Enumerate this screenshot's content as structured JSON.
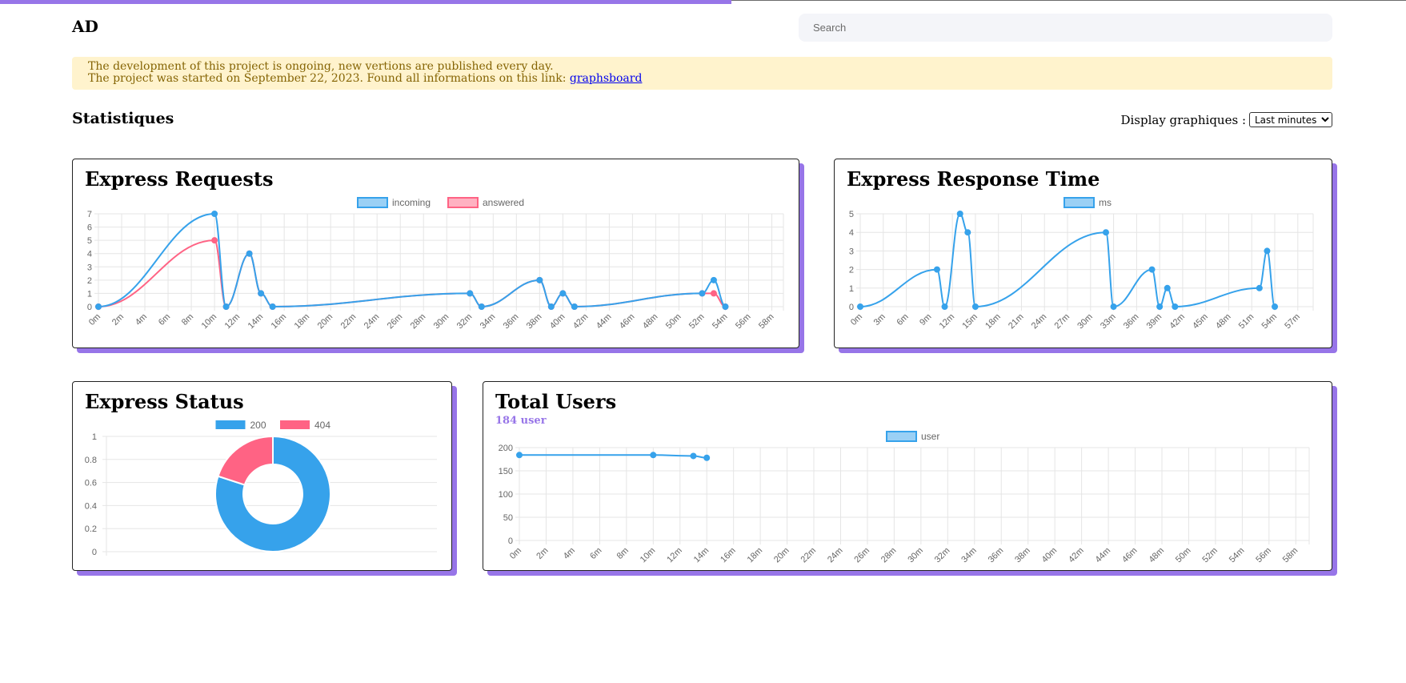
{
  "header": {
    "brand": "AD",
    "search_placeholder": "Search",
    "progress_fraction": 0.52
  },
  "notice": {
    "line1": "The development of this project is ongoing, new vertions are published every day.",
    "line2_prefix": "The project was started on September 22, 2023. Found all informations on this link:",
    "link_label": "graphsboard"
  },
  "stats": {
    "title": "Statistiques",
    "display_label": "Display graphiques :",
    "display_selected": "Last minutes",
    "display_options": [
      "Last minutes"
    ]
  },
  "colors": {
    "accent": "#9775e8",
    "blue": "#36a2eb",
    "pink": "#ff6384"
  },
  "cards": {
    "requests": {
      "title": "Express Requests"
    },
    "response": {
      "title": "Express Response Time"
    },
    "status": {
      "title": "Express Status"
    },
    "users": {
      "title": "Total Users",
      "subtitle": "184 user"
    }
  },
  "chart_data": [
    {
      "id": "requests",
      "type": "line",
      "title": "Express Requests",
      "x_ticks": [
        "0m",
        "2m",
        "4m",
        "6m",
        "8m",
        "10m",
        "12m",
        "14m",
        "16m",
        "18m",
        "20m",
        "22m",
        "24m",
        "26m",
        "28m",
        "30m",
        "32m",
        "34m",
        "36m",
        "38m",
        "40m",
        "42m",
        "44m",
        "46m",
        "48m",
        "50m",
        "52m",
        "54m",
        "56m",
        "58m"
      ],
      "y_ticks": [
        0,
        1,
        2,
        3,
        4,
        5,
        6,
        7
      ],
      "ylim": [
        0,
        7
      ],
      "xlim": [
        0,
        59
      ],
      "series": [
        {
          "name": "incoming",
          "color": "#36a2eb",
          "points": [
            [
              0,
              0
            ],
            [
              10,
              7
            ],
            [
              11,
              0
            ],
            [
              13,
              4
            ],
            [
              14,
              1
            ],
            [
              15,
              0
            ],
            [
              32,
              1
            ],
            [
              33,
              0
            ],
            [
              38,
              2
            ],
            [
              39,
              0
            ],
            [
              40,
              1
            ],
            [
              41,
              0
            ],
            [
              52,
              1
            ],
            [
              53,
              2
            ],
            [
              54,
              0
            ]
          ]
        },
        {
          "name": "answered",
          "color": "#ff6384",
          "points": [
            [
              0,
              0
            ],
            [
              10,
              5
            ],
            [
              11,
              0
            ],
            [
              13,
              4
            ],
            [
              14,
              1
            ],
            [
              15,
              0
            ],
            [
              32,
              1
            ],
            [
              33,
              0
            ],
            [
              38,
              2
            ],
            [
              39,
              0
            ],
            [
              40,
              1
            ],
            [
              41,
              0
            ],
            [
              52,
              1
            ],
            [
              53,
              1
            ],
            [
              54,
              0
            ]
          ]
        }
      ]
    },
    {
      "id": "response",
      "type": "line",
      "title": "Express Response Time",
      "x_ticks": [
        "0m",
        "3m",
        "6m",
        "9m",
        "12m",
        "15m",
        "18m",
        "21m",
        "24m",
        "27m",
        "30m",
        "33m",
        "36m",
        "39m",
        "42m",
        "45m",
        "48m",
        "51m",
        "54m",
        "57m"
      ],
      "y_ticks": [
        0,
        1,
        2,
        3,
        4,
        5
      ],
      "ylim": [
        0,
        5
      ],
      "xlim": [
        0,
        59
      ],
      "series": [
        {
          "name": "ms",
          "color": "#36a2eb",
          "points": [
            [
              0,
              0
            ],
            [
              10,
              2
            ],
            [
              11,
              0
            ],
            [
              13,
              5
            ],
            [
              14,
              4
            ],
            [
              15,
              0
            ],
            [
              32,
              4
            ],
            [
              33,
              0
            ],
            [
              38,
              2
            ],
            [
              39,
              0
            ],
            [
              40,
              1
            ],
            [
              41,
              0
            ],
            [
              52,
              1
            ],
            [
              53,
              3
            ],
            [
              54,
              0
            ]
          ]
        }
      ]
    },
    {
      "id": "status",
      "type": "pie",
      "title": "Express Status",
      "y_ticks": [
        0,
        0.2,
        0.4,
        0.6,
        0.8,
        1
      ],
      "slices": [
        {
          "label": "200",
          "value": 0.8,
          "color": "#36a2eb"
        },
        {
          "label": "404",
          "value": 0.2,
          "color": "#ff6384"
        }
      ]
    },
    {
      "id": "users",
      "type": "line",
      "title": "Total Users",
      "x_ticks": [
        "0m",
        "2m",
        "4m",
        "6m",
        "8m",
        "10m",
        "12m",
        "14m",
        "16m",
        "18m",
        "20m",
        "22m",
        "24m",
        "26m",
        "28m",
        "30m",
        "32m",
        "34m",
        "36m",
        "38m",
        "40m",
        "42m",
        "44m",
        "46m",
        "48m",
        "50m",
        "52m",
        "54m",
        "56m",
        "58m"
      ],
      "y_ticks": [
        0,
        50,
        100,
        150,
        200
      ],
      "ylim": [
        0,
        200
      ],
      "xlim": [
        0,
        59
      ],
      "series": [
        {
          "name": "user",
          "color": "#36a2eb",
          "points": [
            [
              0,
              184
            ],
            [
              10,
              184
            ],
            [
              13,
              182
            ],
            [
              14,
              178
            ]
          ]
        }
      ]
    }
  ]
}
